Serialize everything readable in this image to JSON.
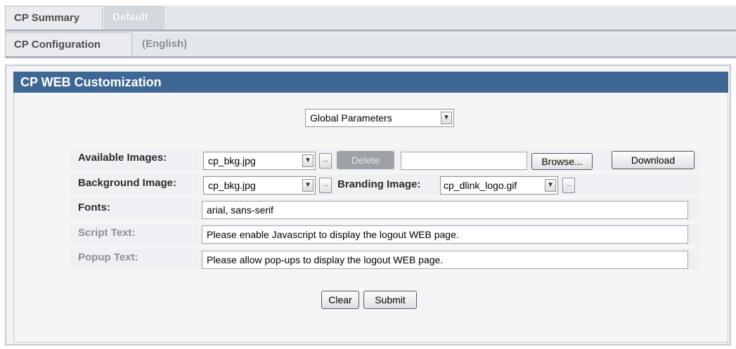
{
  "tabs_primary": [
    {
      "label": "CP Summary"
    },
    {
      "label": "Default"
    }
  ],
  "tabs_secondary": [
    {
      "label": "CP Configuration"
    },
    {
      "label": "(English)"
    }
  ],
  "panel": {
    "title": "CP WEB Customization",
    "parameters_select": "Global Parameters",
    "rows": {
      "available_images": {
        "label": "Available Images:",
        "select_value": "cp_bkg.jpg",
        "delete_label": "Delete",
        "file_value": "",
        "browse_label": "Browse...",
        "download_label": "Download"
      },
      "background_image": {
        "label": "Background Image:",
        "select_value": "cp_bkg.jpg",
        "branding_label": "Branding Image:",
        "branding_value": "cp_dlink_logo.gif"
      },
      "fonts": {
        "label": "Fonts:",
        "value": "arial, sans-serif"
      },
      "script_text": {
        "label": "Script Text:",
        "value": "Please enable Javascript to display the logout WEB page."
      },
      "popup_text": {
        "label": "Popup Text:",
        "value": "Please allow pop-ups to display the logout WEB page."
      }
    },
    "clear_label": "Clear",
    "submit_label": "Submit",
    "ellipsis": "..."
  }
}
